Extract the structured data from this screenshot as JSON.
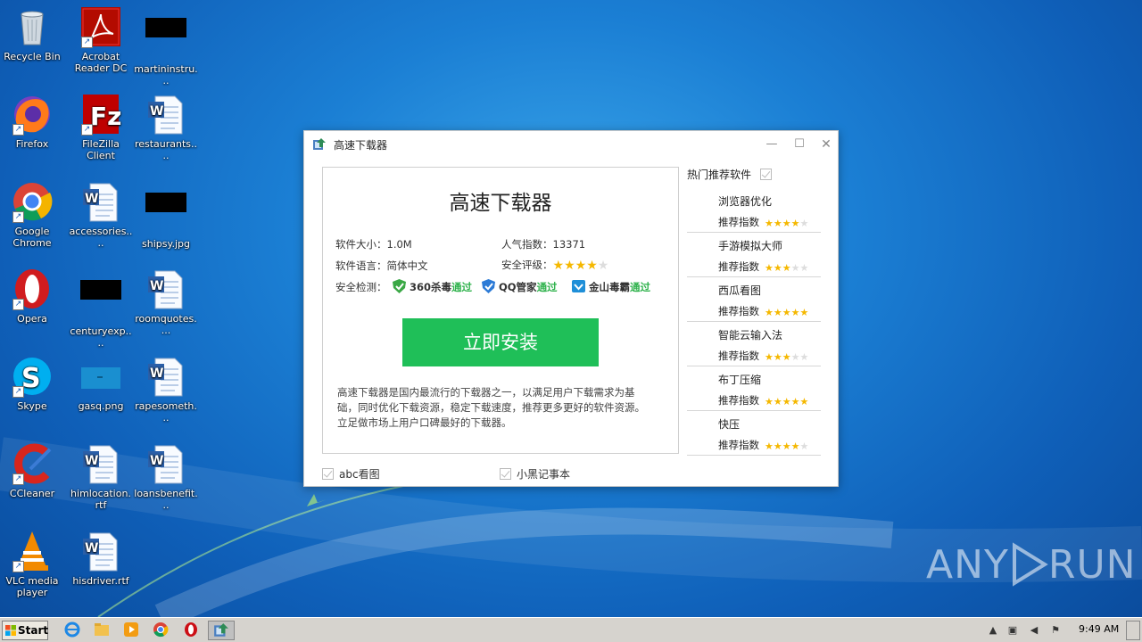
{
  "desktop": {
    "icons": [
      {
        "label": "Recycle Bin",
        "icon": "recycle-bin-icon"
      },
      {
        "label": "Acrobat Reader DC",
        "icon": "acrobat-icon"
      },
      {
        "label": "martininstru...",
        "icon": "black-thumbnail-icon"
      },
      {
        "label": "Firefox",
        "icon": "firefox-icon"
      },
      {
        "label": "FileZilla Client",
        "icon": "filezilla-icon"
      },
      {
        "label": "restaurants....",
        "icon": "word-doc-icon"
      },
      {
        "label": "Google Chrome",
        "icon": "chrome-icon"
      },
      {
        "label": "accessories....",
        "icon": "word-doc-icon"
      },
      {
        "label": "shipsy.jpg",
        "icon": "black-thumbnail-icon"
      },
      {
        "label": "Opera",
        "icon": "opera-icon"
      },
      {
        "label": "centuryexp....",
        "icon": "black-thumbnail-icon"
      },
      {
        "label": "roomquotes....",
        "icon": "word-doc-icon"
      },
      {
        "label": "Skype",
        "icon": "skype-icon"
      },
      {
        "label": "gasq.png",
        "icon": "image-thumbnail-icon"
      },
      {
        "label": "rapesometh...",
        "icon": "word-doc-icon"
      },
      {
        "label": "CCleaner",
        "icon": "ccleaner-icon"
      },
      {
        "label": "himlocation.rtf",
        "icon": "word-doc-icon"
      },
      {
        "label": "loansbenefit...",
        "icon": "word-doc-icon"
      },
      {
        "label": "VLC media player",
        "icon": "vlc-icon"
      },
      {
        "label": "hisdriver.rtf",
        "icon": "word-doc-icon"
      }
    ]
  },
  "dialog": {
    "window_title": "高速下载器",
    "app_name": "高速下载器",
    "size_label": "软件大小：1.0M",
    "popularity_label": "人气指数：13371",
    "language_label": "软件语言：简体中文",
    "safety_label": "安全评级：",
    "safety_stars": 4,
    "security_label": "安全检测：",
    "security_checks": [
      {
        "name": "360杀毒",
        "result": "通过"
      },
      {
        "name": "QQ管家",
        "result": "通过"
      },
      {
        "name": "金山毒霸",
        "result": "通过"
      }
    ],
    "install_button": "立即安装",
    "description": "高速下载器是国内最流行的下载器之一，以满足用户下载需求为基础，同时优化下载资源，稳定下载速度，推荐更多更好的软件资源。立足做市场上用户口碑最好的下载器。",
    "bottom_options": [
      {
        "label": "abc看图",
        "checked": true
      },
      {
        "label": "小黑记事本",
        "checked": true
      }
    ],
    "recommend_header": "热门推荐软件",
    "recommend_label": "推荐指数",
    "recommendations": [
      {
        "name": "浏览器优化",
        "stars": 4
      },
      {
        "name": "手游模拟大师",
        "stars": 3
      },
      {
        "name": "西瓜看图",
        "stars": 5
      },
      {
        "name": "智能云输入法",
        "stars": 3
      },
      {
        "name": "布丁压缩",
        "stars": 5
      },
      {
        "name": "快压",
        "stars": 4
      }
    ]
  },
  "taskbar": {
    "start_label": "Start",
    "clock": "9:49 AM"
  },
  "watermark": {
    "left": "ANY",
    "right": "RUN"
  },
  "colors": {
    "install_green": "#1fbf58",
    "pass_green": "#2fb24c",
    "star_gold": "#f5b800"
  }
}
